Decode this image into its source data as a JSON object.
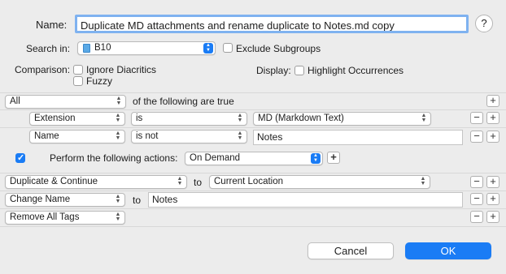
{
  "name_label": "Name:",
  "name_value": "Duplicate MD attachments and rename duplicate to Notes.md copy",
  "help_label": "?",
  "search_in_label": "Search in:",
  "search_in_value": "B10",
  "exclude_subgroups_label": "Exclude Subgroups",
  "comparison_label": "Comparison:",
  "ignore_diacritics_label": "Ignore Diacritics",
  "fuzzy_label": "Fuzzy",
  "display_label": "Display:",
  "highlight_occurrences_label": "Highlight Occurrences",
  "match_mode": "All",
  "match_suffix": "of the following are true",
  "conditions": [
    {
      "field": "Extension",
      "operator": "is",
      "value": "MD (Markdown Text)"
    },
    {
      "field": "Name",
      "operator": "is not",
      "value": "Notes"
    }
  ],
  "perform_label": "Perform the following actions:",
  "perform_mode": "On Demand",
  "actions": [
    {
      "action": "Duplicate & Continue",
      "connector": "to",
      "target": "Current Location"
    },
    {
      "action": "Change Name",
      "connector": "to",
      "target": "Notes"
    },
    {
      "action": "Remove All Tags"
    }
  ],
  "plus_symbol": "+",
  "minus_symbol": "−",
  "cancel_label": "Cancel",
  "ok_label": "OK",
  "colors": {
    "accent": "#1a7cf5",
    "background": "#ececec"
  }
}
